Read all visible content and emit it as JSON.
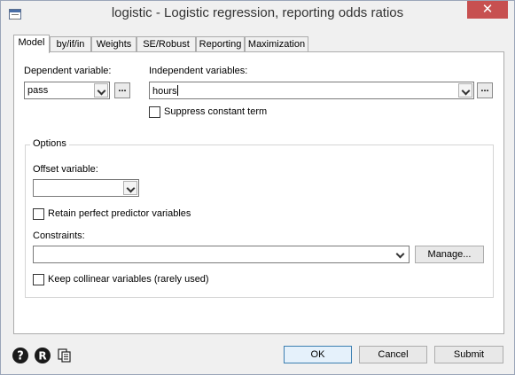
{
  "window": {
    "title": "logistic - Logistic regression, reporting odds ratios",
    "close_glyph": "✕"
  },
  "tabs": [
    {
      "label": "Model",
      "active": true
    },
    {
      "label": "by/if/in"
    },
    {
      "label": "Weights"
    },
    {
      "label": "SE/Robust"
    },
    {
      "label": "Reporting"
    },
    {
      "label": "Maximization"
    }
  ],
  "model": {
    "dependent_label": "Dependent variable:",
    "dependent_value": "pass",
    "independent_label": "Independent variables:",
    "independent_value": "hours",
    "browse_label": "...",
    "suppress_label": "Suppress constant term",
    "suppress_checked": false,
    "options_title": "Options",
    "offset_label": "Offset variable:",
    "offset_value": "",
    "retain_label": "Retain perfect predictor variables",
    "retain_checked": false,
    "constraints_label": "Constraints:",
    "constraints_value": "",
    "manage_label": "Manage...",
    "collinear_label": "Keep collinear variables (rarely used)",
    "collinear_checked": false
  },
  "footer": {
    "help_icon": "help-icon",
    "reset_icon": "reset-icon",
    "copy_icon": "copy-icon",
    "ok_label": "OK",
    "cancel_label": "Cancel",
    "submit_label": "Submit"
  },
  "colors": {
    "close_bg": "#c75050",
    "default_button_border": "#3c7fb1"
  }
}
